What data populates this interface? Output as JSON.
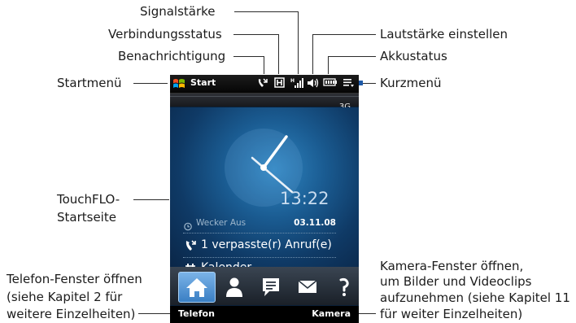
{
  "annotations": {
    "signal": "Signalstärke",
    "connection": "Verbindungsstatus",
    "notification": "Benachrichtigung",
    "start_menu": "Startmenü",
    "volume": "Lautstärke einstellen",
    "battery": "Akkustatus",
    "quick_menu": "Kurzmenü",
    "touchflo_line1": "TouchFLO-",
    "touchflo_line2": "Startseite",
    "phone_line1": "Telefon-Fenster öffnen",
    "phone_line2": "(siehe Kapitel 2 für",
    "phone_line3": "weitere Einzelheiten)",
    "camera_line1": "Kamera-Fenster öffnen,",
    "camera_line2": "um Bilder und Videoclips",
    "camera_line3": "aufzunehmen (siehe Kapitel 11",
    "camera_line4": "für weiter Einzelheiten)"
  },
  "phone": {
    "start_label": "Start",
    "network_type": "3G",
    "time": "13:22",
    "alarm": "Wecker Aus",
    "date": "03.11.08",
    "missed_calls": "1 verpasste(r) Anruf(e)",
    "calendar": "Kalender",
    "softkey_left": "Telefon",
    "softkey_right": "Kamera",
    "status_icons": [
      "missed-call-icon",
      "connection-icon",
      "signal-icon",
      "volume-icon",
      "battery-icon",
      "menu-icon"
    ],
    "tabs": [
      "home-tab",
      "people-tab",
      "messages-tab",
      "email-tab",
      "internet-tab"
    ]
  },
  "colors": {
    "accent": "#1e5aa8",
    "home_bg": "#1a5b91"
  }
}
